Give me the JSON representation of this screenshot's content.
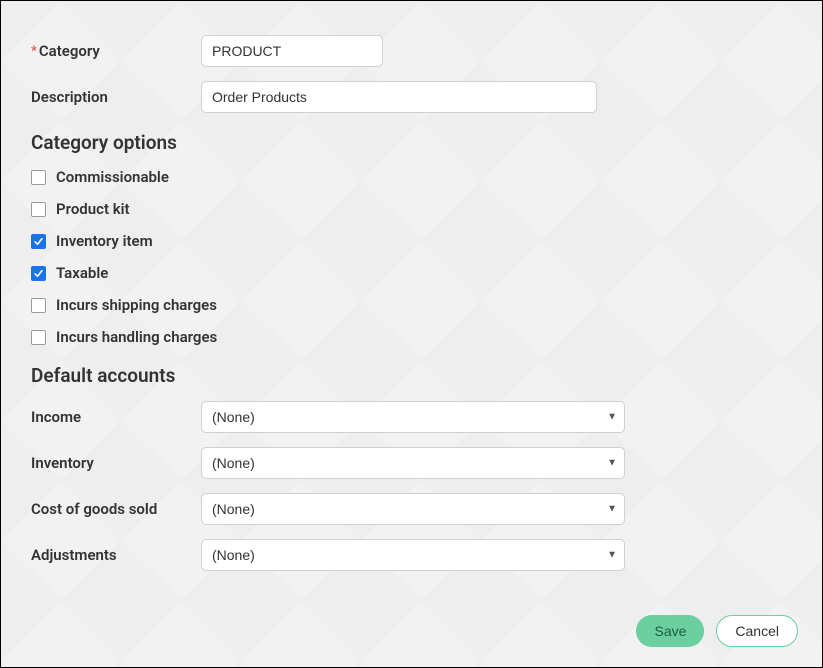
{
  "fields": {
    "category": {
      "label": "Category",
      "value": "PRODUCT",
      "required": true
    },
    "description": {
      "label": "Description",
      "value": "Order Products"
    }
  },
  "sections": {
    "options_heading": "Category options",
    "accounts_heading": "Default accounts"
  },
  "options": {
    "commissionable": {
      "label": "Commissionable",
      "checked": false
    },
    "product_kit": {
      "label": "Product kit",
      "checked": false
    },
    "inventory_item": {
      "label": "Inventory item",
      "checked": true
    },
    "taxable": {
      "label": "Taxable",
      "checked": true
    },
    "shipping": {
      "label": "Incurs shipping charges",
      "checked": false
    },
    "handling": {
      "label": "Incurs handling charges",
      "checked": false
    }
  },
  "accounts": {
    "income": {
      "label": "Income",
      "value": "(None)"
    },
    "inventory": {
      "label": "Inventory",
      "value": "(None)"
    },
    "cogs": {
      "label": "Cost of goods sold",
      "value": "(None)"
    },
    "adjustments": {
      "label": "Adjustments",
      "value": "(None)"
    }
  },
  "buttons": {
    "save": "Save",
    "cancel": "Cancel"
  }
}
